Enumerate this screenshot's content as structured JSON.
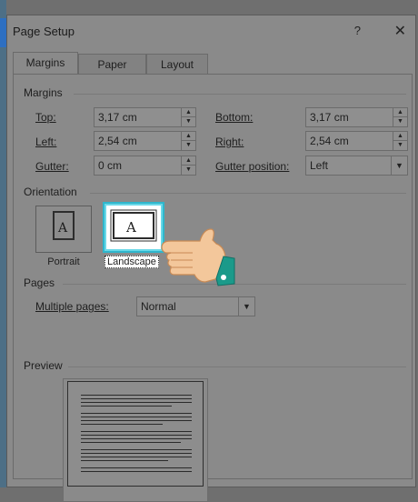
{
  "dialog": {
    "title": "Page Setup",
    "help": "?",
    "close": "✕"
  },
  "tabs": [
    {
      "label": "Margins",
      "active": true
    },
    {
      "label": "Paper",
      "active": false
    },
    {
      "label": "Layout",
      "active": false
    }
  ],
  "margins": {
    "section": "Margins",
    "top": {
      "label": "Top:",
      "value": "3,17 cm"
    },
    "bottom": {
      "label": "Bottom:",
      "value": "3,17 cm"
    },
    "left": {
      "label": "Left:",
      "value": "2,54 cm"
    },
    "right": {
      "label": "Right:",
      "value": "2,54 cm"
    },
    "gutter": {
      "label": "Gutter:",
      "value": "0 cm"
    },
    "gutter_position": {
      "label": "Gutter position:",
      "value": "Left"
    }
  },
  "orientation": {
    "section": "Orientation",
    "portrait": "Portrait",
    "landscape": "Landscape",
    "selected": "landscape"
  },
  "pages": {
    "section": "Pages",
    "multiple_label": "Multiple pages:",
    "multiple_value": "Normal"
  },
  "preview": {
    "section": "Preview"
  },
  "colors": {
    "selection_glow": "#2fb6cc",
    "hand_skin": "#f3c79b",
    "hand_cuff": "#1b9a8a"
  }
}
